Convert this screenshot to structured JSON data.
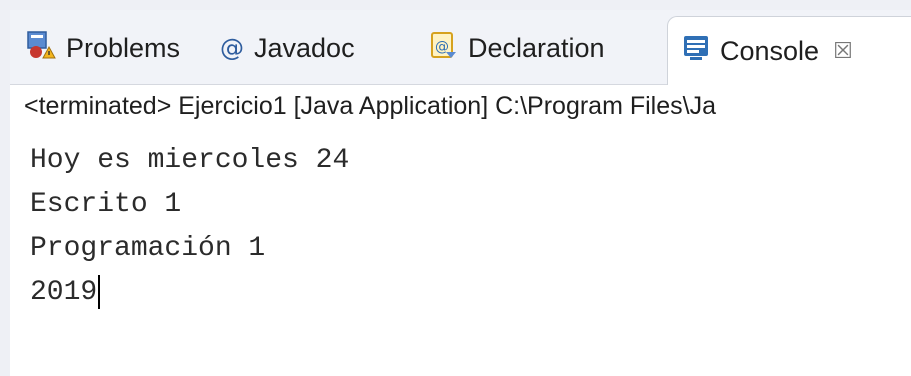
{
  "tabs": [
    {
      "label": "Problems",
      "icon": "problems-icon"
    },
    {
      "label": "Javadoc",
      "icon": "javadoc-at-icon"
    },
    {
      "label": "Declaration",
      "icon": "declaration-icon"
    },
    {
      "label": "Console",
      "icon": "console-icon",
      "active": true
    }
  ],
  "close_glyph": "☒",
  "at_glyph": "@",
  "status": {
    "text": "<terminated> Ejercicio1 [Java Application] C:\\Program Files\\Ja"
  },
  "console": {
    "lines": [
      "Hoy es miercoles 24",
      "Escrito 1",
      "Programación 1",
      "2019"
    ]
  },
  "colors": {
    "tabbar_bg": "#f1f3f8",
    "console_icon": "#2f6fb5",
    "declaration_icon": "#d6a21f",
    "problems_icon": "#c7372f"
  }
}
